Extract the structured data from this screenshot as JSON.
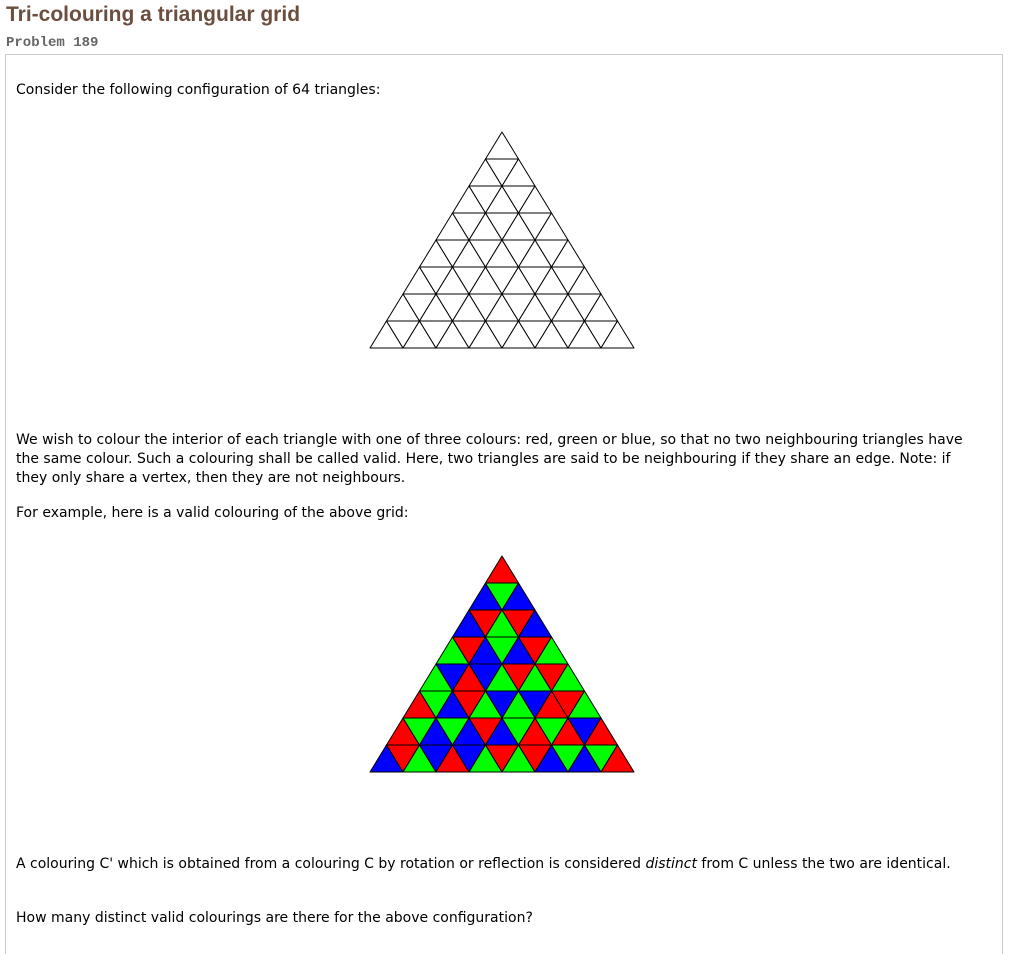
{
  "page": {
    "title": "Tri-colouring a triangular grid",
    "problem_id": "Problem 189"
  },
  "content": {
    "para1": "Consider the following configuration of 64 triangles:",
    "para2": "We wish to colour the interior of each triangle with one of three colours: red, green or blue, so that no two neighbouring triangles have the same colour. Such a colouring shall be called valid. Here, two triangles are said to be neighbouring if they share an edge. Note: if they only share a vertex, then they are not neighbours.",
    "para3": "For example, here is a valid colouring of the above grid:",
    "para4_before": "A colouring C' which is obtained from a colouring C by rotation or reflection is considered ",
    "para4_emphasis": "distinct",
    "para4_after": " from C unless the two are identical.",
    "para5": "How many distinct valid colourings are there for the above configuration?"
  },
  "figures": {
    "rows": 8,
    "triangle_count": 64,
    "palette": {
      "R": "#ff0000",
      "G": "#00ff00",
      "B": "#0000ff",
      "line": "#000000",
      "blank": "#ffffff"
    },
    "coloring": [
      "R",
      "BGB",
      "BRGRB",
      "GRBGBRG",
      "GBRBGRGRG",
      "RGBRGBGBRRG",
      "RGBGBRBGRGRBR",
      "BRGBRBGRGRBGBGR"
    ]
  }
}
